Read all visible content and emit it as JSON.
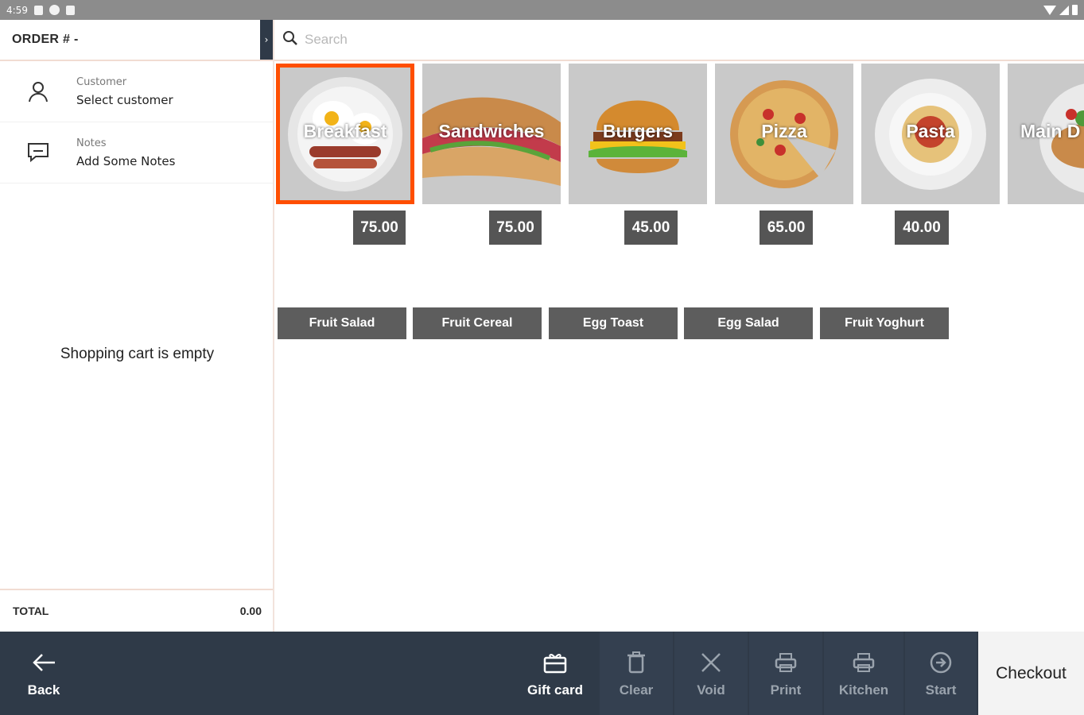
{
  "status_bar": {
    "time": "4:59"
  },
  "order": {
    "title": "ORDER # -",
    "collapse_glyph": "›"
  },
  "customer": {
    "label": "Customer",
    "value": "Select customer"
  },
  "notes": {
    "label": "Notes",
    "value": "Add Some Notes"
  },
  "cart": {
    "empty_message": "Shopping cart is empty",
    "total_label": "TOTAL",
    "total_value": "0.00"
  },
  "search": {
    "placeholder": "Search"
  },
  "categories": [
    {
      "name": "Breakfast",
      "price": "75.00",
      "selected": true
    },
    {
      "name": "Sandwiches",
      "price": "75.00"
    },
    {
      "name": "Burgers",
      "price": "45.00"
    },
    {
      "name": "Pizza",
      "price": "65.00"
    },
    {
      "name": "Pasta",
      "price": "40.00"
    },
    {
      "name": "Main D"
    }
  ],
  "products": [
    "Fruit Salad",
    "Fruit Cereal",
    "Egg Toast",
    "Egg Salad",
    "Fruit Yoghurt"
  ],
  "bottom_bar": {
    "back": "Back",
    "gift_card": "Gift card",
    "clear": "Clear",
    "void": "Void",
    "print": "Print",
    "kitchen": "Kitchen",
    "start": "Start",
    "checkout": "Checkout"
  },
  "colors": {
    "accent": "#ff4e00",
    "bar": "#2f3a48",
    "price_bg": "#555555",
    "product_bg": "#5d5d5d"
  }
}
